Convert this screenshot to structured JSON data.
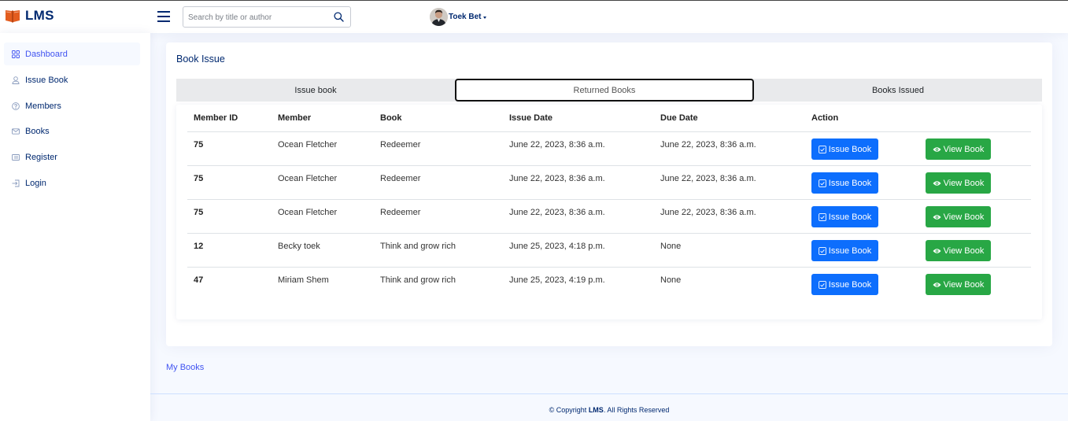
{
  "app": {
    "name": "LMS"
  },
  "search": {
    "placeholder": "Search by title or author"
  },
  "user": {
    "name": "Toek Bet"
  },
  "sidebar": {
    "items": [
      {
        "label": "Dashboard",
        "icon": "grid-icon",
        "active": true
      },
      {
        "label": "Issue Book",
        "icon": "person-icon",
        "active": false
      },
      {
        "label": "Members",
        "icon": "question-circle-icon",
        "active": false
      },
      {
        "label": "Books",
        "icon": "envelope-icon",
        "active": false
      },
      {
        "label": "Register",
        "icon": "card-list-icon",
        "active": false
      },
      {
        "label": "Login",
        "icon": "box-arrow-in-right-icon",
        "active": false
      }
    ]
  },
  "card": {
    "title": "Book Issue",
    "tabs": [
      {
        "label": "Issue book",
        "active": false
      },
      {
        "label": "Returned Books",
        "active": true
      },
      {
        "label": "Books Issued",
        "active": false
      }
    ]
  },
  "table": {
    "headers": [
      "Member ID",
      "Member",
      "Book",
      "Issue Date",
      "Due Date",
      "Action"
    ],
    "issue_label": "Issue Book",
    "view_label": "View Book",
    "rows": [
      {
        "member_id": "75",
        "member": "Ocean Fletcher",
        "book": "Redeemer",
        "issue_date": "June 22, 2023, 8:36 a.m.",
        "due_date": "June 22, 2023, 8:36 a.m."
      },
      {
        "member_id": "75",
        "member": "Ocean Fletcher",
        "book": "Redeemer",
        "issue_date": "June 22, 2023, 8:36 a.m.",
        "due_date": "June 22, 2023, 8:36 a.m."
      },
      {
        "member_id": "75",
        "member": "Ocean Fletcher",
        "book": "Redeemer",
        "issue_date": "June 22, 2023, 8:36 a.m.",
        "due_date": "June 22, 2023, 8:36 a.m."
      },
      {
        "member_id": "12",
        "member": "Becky toek",
        "book": "Think and grow rich",
        "issue_date": "June 25, 2023, 4:18 p.m.",
        "due_date": "None"
      },
      {
        "member_id": "47",
        "member": "Miriam Shem",
        "book": "Think and grow rich",
        "issue_date": "June 25, 2023, 4:19 p.m.",
        "due_date": "None"
      }
    ]
  },
  "links": {
    "my_books": "My Books"
  },
  "footer": {
    "prefix": "© Copyright",
    "brand": "LMS",
    "suffix": ". All Rights Reserved"
  },
  "colors": {
    "primary": "#012970",
    "accent": "#4154f1",
    "issue_button": "#0d6efd",
    "view_button": "#28a745",
    "logo": "#e35d1f"
  }
}
